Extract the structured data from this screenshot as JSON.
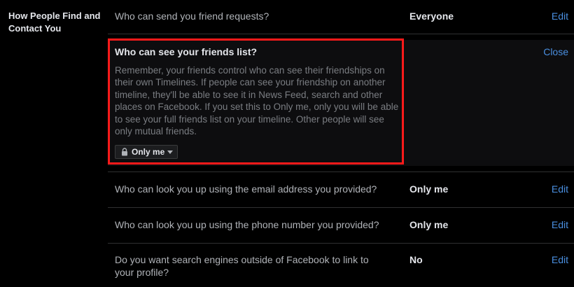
{
  "section": {
    "title": "How People Find and Contact You"
  },
  "rows": [
    {
      "question": "Who can send you friend requests?",
      "value": "Everyone",
      "action": "Edit"
    },
    {
      "question": "Who can look you up using the email address you provided?",
      "value": "Only me",
      "action": "Edit"
    },
    {
      "question": "Who can look you up using the phone number you provided?",
      "value": "Only me",
      "action": "Edit"
    },
    {
      "question": "Do you want search engines outside of Facebook to link to your profile?",
      "value": "No",
      "action": "Edit"
    }
  ],
  "expanded": {
    "title": "Who can see your friends list?",
    "description": "Remember, your friends control who can see their friendships on their own Timelines. If people can see your friendship on another timeline, they'll be able to see it in News Feed, search and other places on Facebook. If you set this to Only me, only you will be able to see your full friends list on your timeline. Other people will see only mutual friends.",
    "close_label": "Close",
    "privacy_selector": {
      "selected": "Only me",
      "icon": "lock-icon"
    }
  },
  "colors": {
    "background": "#000000",
    "link": "#4a8fe0",
    "highlight_border": "#ff1a1a",
    "text_primary": "#e4e6eb",
    "text_secondary": "#b0b3b8"
  }
}
